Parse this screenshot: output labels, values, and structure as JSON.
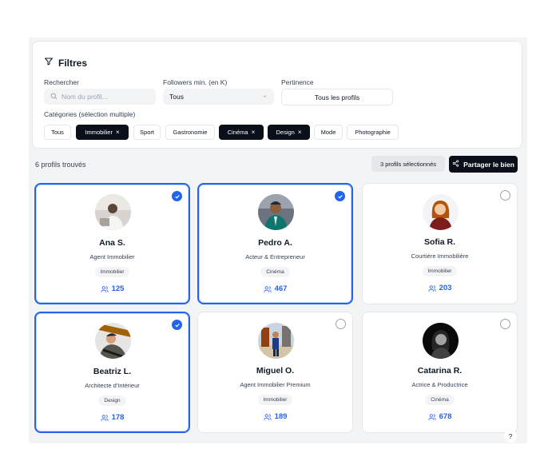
{
  "filters": {
    "title": "Filtres",
    "search_label": "Rechercher",
    "search_placeholder": "Nom du profil...",
    "search_value": "",
    "followers_label": "Followers min. (en K)",
    "followers_value": "Tous",
    "pertinence_label": "Pertinence",
    "pertinence_value": "Tous les profils",
    "categories_label": "Catégories (sélection multiple)",
    "categories": [
      {
        "label": "Tous",
        "selected": false
      },
      {
        "label": "Immobilier",
        "selected": true
      },
      {
        "label": "Sport",
        "selected": false
      },
      {
        "label": "Gastronomie",
        "selected": false
      },
      {
        "label": "Cinéma",
        "selected": true
      },
      {
        "label": "Design",
        "selected": true
      },
      {
        "label": "Mode",
        "selected": false
      },
      {
        "label": "Photographie",
        "selected": false
      }
    ]
  },
  "results": {
    "count_text": "6 profils trouvés",
    "selected_text": "3 profils sélectionnés",
    "share_label": "Partager le bien"
  },
  "profiles": [
    {
      "name": "Ana S.",
      "role": "Agent Immobilier",
      "category": "Immobilier",
      "followers": "125",
      "selected": true
    },
    {
      "name": "Pedro A.",
      "role": "Acteur & Entrepreneur",
      "category": "Cinéma",
      "followers": "467",
      "selected": true
    },
    {
      "name": "Sofia R.",
      "role": "Courtière Immobilière",
      "category": "Immobilier",
      "followers": "203",
      "selected": false
    },
    {
      "name": "Beatriz L.",
      "role": "Architecte d'Intérieur",
      "category": "Design",
      "followers": "178",
      "selected": true
    },
    {
      "name": "Miguel O.",
      "role": "Agent Immobilier Premium",
      "category": "Immobilier",
      "followers": "189",
      "selected": false
    },
    {
      "name": "Catarina R.",
      "role": "Actrice & Productrice",
      "category": "Cinéma",
      "followers": "678",
      "selected": false
    }
  ],
  "help_label": "?",
  "colors": {
    "accent": "#2563eb",
    "dark": "#0b0f19",
    "muted_bg": "#f3f4f6"
  }
}
